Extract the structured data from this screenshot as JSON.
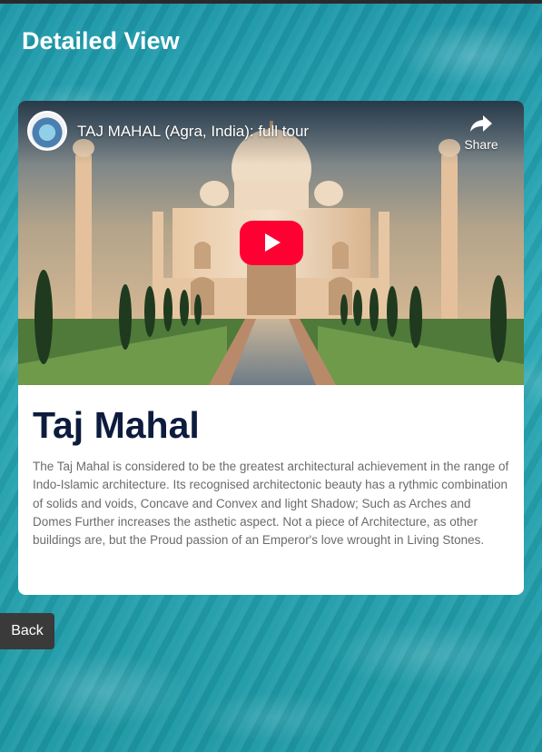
{
  "page": {
    "title": "Detailed View"
  },
  "video": {
    "title": "TAJ MAHAL (Agra, India): full tour",
    "share_label": "Share",
    "icons": {
      "share": "share-arrow-icon",
      "play": "play-icon",
      "channel": "channel-avatar-icon"
    },
    "colors": {
      "play_button": "#ff0033"
    }
  },
  "place": {
    "name": "Taj Mahal",
    "description": "The Taj Mahal is considered to be the greatest architectural achievement in the range of Indo-Islamic architecture. Its recognised architectonic beauty has a rythmic combination of solids and voids, Concave and Convex and light Shadow; Such as Arches and Domes Further increases the asthetic aspect. Not a piece of Architecture, as other buildings are, but the Proud passion of an Emperor's love wrought in Living Stones."
  },
  "actions": {
    "back_label": "Back"
  },
  "colors": {
    "background": "#2aa9b6",
    "title_text": "#0d1b3e",
    "back_button": "#3a3a3a"
  }
}
